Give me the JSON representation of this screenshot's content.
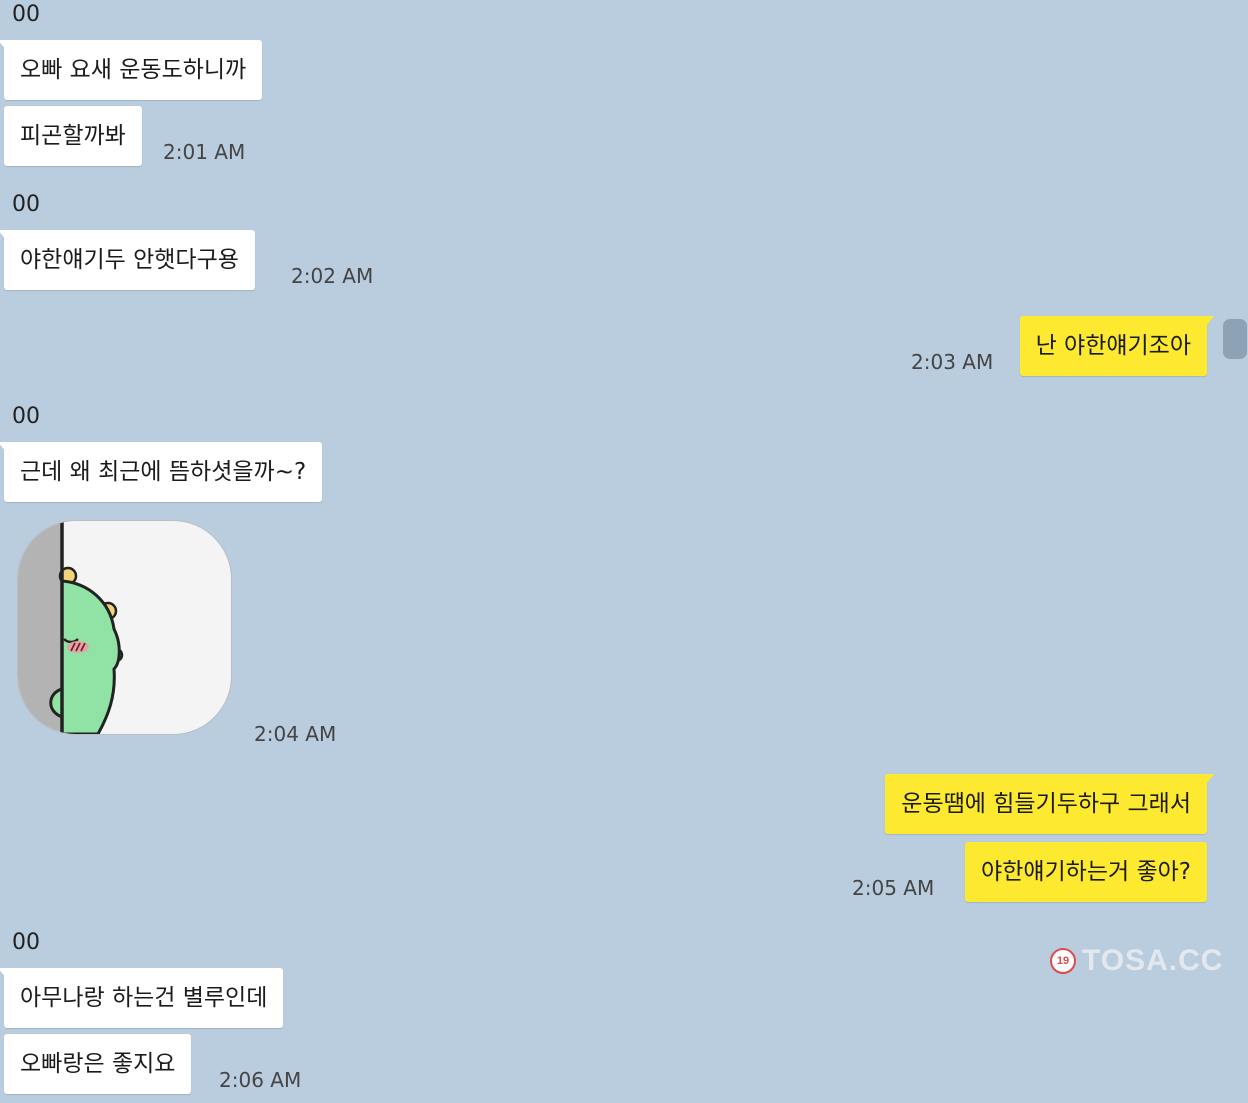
{
  "chat": {
    "messages": [
      {
        "sender": "00",
        "text": "오빠 요새 운동도하니까"
      },
      {
        "text": "피곤할까봐",
        "time": "2:01 AM"
      },
      {
        "sender": "00",
        "text": "야한얘기두 안햇다구용",
        "time": "2:02 AM"
      },
      {
        "text": "난 야한얘기조아",
        "time": "2:03 AM"
      },
      {
        "sender": "00",
        "text": "근데 왜 최근에 뜸하셧을까~?"
      },
      {
        "sticker": "peeking-dinosaur-sticker",
        "time": "2:04 AM"
      },
      {
        "text": "운동땜에 힘들기두하구 그래서"
      },
      {
        "text": "야한얘기하는거 좋아?",
        "time": "2:05 AM"
      },
      {
        "sender": "00",
        "text": "아무나랑 하는건 별루인데"
      },
      {
        "text": "오빠랑은 좋지요",
        "time": "2:06 AM"
      }
    ]
  },
  "watermark": {
    "badge": "19",
    "text": "TOSA.CC"
  },
  "colors": {
    "background": "#b9cddf",
    "incoming": "#ffffff",
    "outgoing": "#fde92f"
  }
}
